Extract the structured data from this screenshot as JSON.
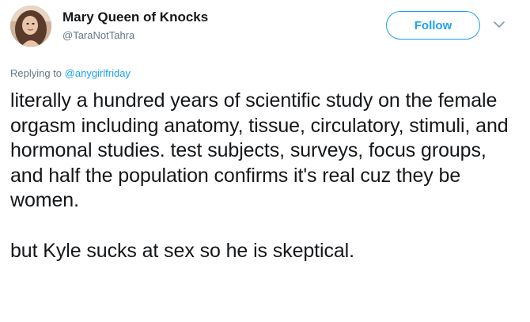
{
  "author": {
    "display_name": "Mary Queen of Knocks",
    "handle": "@TaraNotTahra",
    "avatar_icon": "profile-photo"
  },
  "actions": {
    "follow_label": "Follow",
    "menu_icon": "chevron-down-icon"
  },
  "reply": {
    "prefix": "Replying to ",
    "mention": "@anygirlfriday"
  },
  "tweet": {
    "paragraphs": [
      "literally a hundred years of scientific study on the female orgasm including anatomy, tissue, circulatory, stimuli, and hormonal studies. test subjects, surveys, focus groups, and half the population confirms it's real cuz they be women.",
      "but Kyle sucks at sex so he is skeptical."
    ]
  },
  "colors": {
    "accent": "#1da1f2",
    "secondary_text": "#657786",
    "primary_text": "#14171a"
  }
}
